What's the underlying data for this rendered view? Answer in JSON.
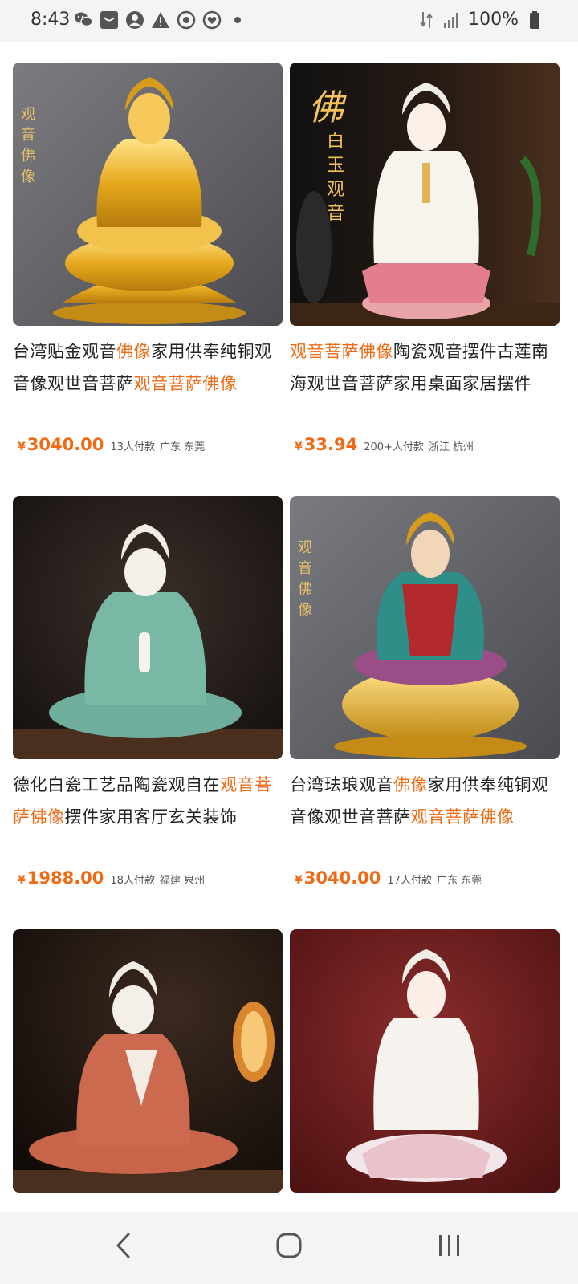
{
  "status_bar": {
    "time": "8:43",
    "battery": "100%",
    "left_icons": [
      "wechat-icon",
      "inbox-icon",
      "account-icon",
      "warning-icon",
      "sync-icon",
      "heart-icon",
      "dot-icon"
    ],
    "right_icons": [
      "data-icon",
      "signal-icon",
      "battery-icon"
    ]
  },
  "products": [
    {
      "title_parts": [
        {
          "text": "台湾贴金观音",
          "hl": false
        },
        {
          "text": "佛像",
          "hl": true
        },
        {
          "text": "家用供奉纯铜观音像观世音菩萨",
          "hl": false
        },
        {
          "text": "观音菩萨佛像",
          "hl": true
        }
      ],
      "price_symbol": "¥",
      "price": "3040.00",
      "sold": "13人付款",
      "location": "广东 东莞",
      "image": "gold-guanyin-statue",
      "image_text": [
        "观",
        "音",
        "佛",
        "像"
      ]
    },
    {
      "title_parts": [
        {
          "text": "观音菩萨佛像",
          "hl": true
        },
        {
          "text": "陶瓷观音摆件古莲南海观世音菩萨家用桌面家居摆件",
          "hl": false
        }
      ],
      "price_symbol": "¥",
      "price": "33.94",
      "sold": "200+人付款",
      "location": "浙江 杭州",
      "image": "white-jade-guanyin-statue",
      "image_text": [
        "佛",
        "白",
        "玉",
        "观",
        "音"
      ]
    },
    {
      "title_parts": [
        {
          "text": "德化白瓷工艺品陶瓷观自在",
          "hl": false
        },
        {
          "text": "观音菩萨佛像",
          "hl": true
        },
        {
          "text": "摆件家用客厅玄关装饰",
          "hl": false
        }
      ],
      "price_symbol": "¥",
      "price": "1988.00",
      "sold": "18人付款",
      "location": "福建 泉州",
      "image": "celadon-guanyin-statue"
    },
    {
      "title_parts": [
        {
          "text": "台湾珐琅观音",
          "hl": false
        },
        {
          "text": "佛像",
          "hl": true
        },
        {
          "text": "家用供奉纯铜观音像观世音菩萨",
          "hl": false
        },
        {
          "text": "观音菩萨佛像",
          "hl": true
        }
      ],
      "price_symbol": "¥",
      "price": "3040.00",
      "sold": "17人付款",
      "location": "广东 东莞",
      "image": "enamel-guanyin-statue",
      "image_text": [
        "观",
        "音",
        "佛",
        "像"
      ]
    },
    {
      "title_parts": [],
      "price_symbol": "",
      "price": "",
      "sold": "",
      "location": "",
      "image": "red-robe-guanyin-statue"
    },
    {
      "title_parts": [],
      "price_symbol": "",
      "price": "",
      "sold": "",
      "location": "",
      "image": "lotus-guanyin-statue"
    }
  ],
  "nav": {
    "back": "back-icon",
    "home": "home-icon",
    "recents": "recents-icon"
  },
  "colors": {
    "highlight": "#f06a13",
    "price": "#f06a13"
  }
}
